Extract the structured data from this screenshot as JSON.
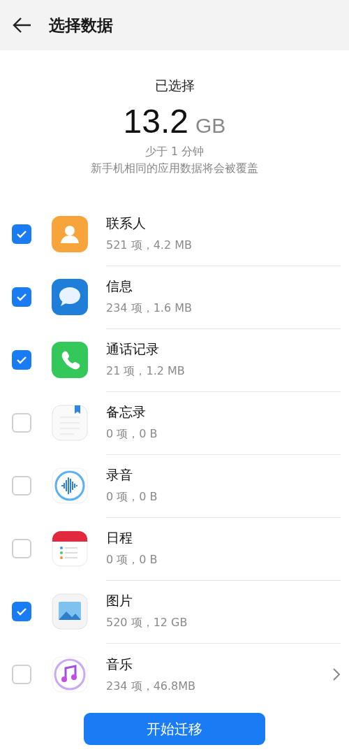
{
  "header": {
    "title": "选择数据"
  },
  "summary": {
    "label": "已选择",
    "amount": "13.2",
    "unit": "GB",
    "duration": "少于 1 分钟",
    "note": "新手机相同的应用数据将会被覆盖"
  },
  "items": [
    {
      "kind": "contacts",
      "name": "联系人",
      "detail": "521 项，4.2 MB",
      "checked": true,
      "expandable": false
    },
    {
      "kind": "messages",
      "name": "信息",
      "detail": "234 项，1.6 MB",
      "checked": true,
      "expandable": false
    },
    {
      "kind": "calls",
      "name": "通话记录",
      "detail": "21 项，1.2 MB",
      "checked": true,
      "expandable": false
    },
    {
      "kind": "notes",
      "name": "备忘录",
      "detail": "0 项，0 B",
      "checked": false,
      "expandable": false
    },
    {
      "kind": "recorder",
      "name": "录音",
      "detail": "0 项，0 B",
      "checked": false,
      "expandable": false
    },
    {
      "kind": "calendar",
      "name": "日程",
      "detail": "0 项，0 B",
      "checked": false,
      "expandable": false
    },
    {
      "kind": "gallery",
      "name": "图片",
      "detail": "520 项，12 GB",
      "checked": true,
      "expandable": false
    },
    {
      "kind": "music",
      "name": "音乐",
      "detail": "234 项，46.8MB",
      "checked": false,
      "expandable": true
    }
  ],
  "action": {
    "label": "开始迁移"
  }
}
